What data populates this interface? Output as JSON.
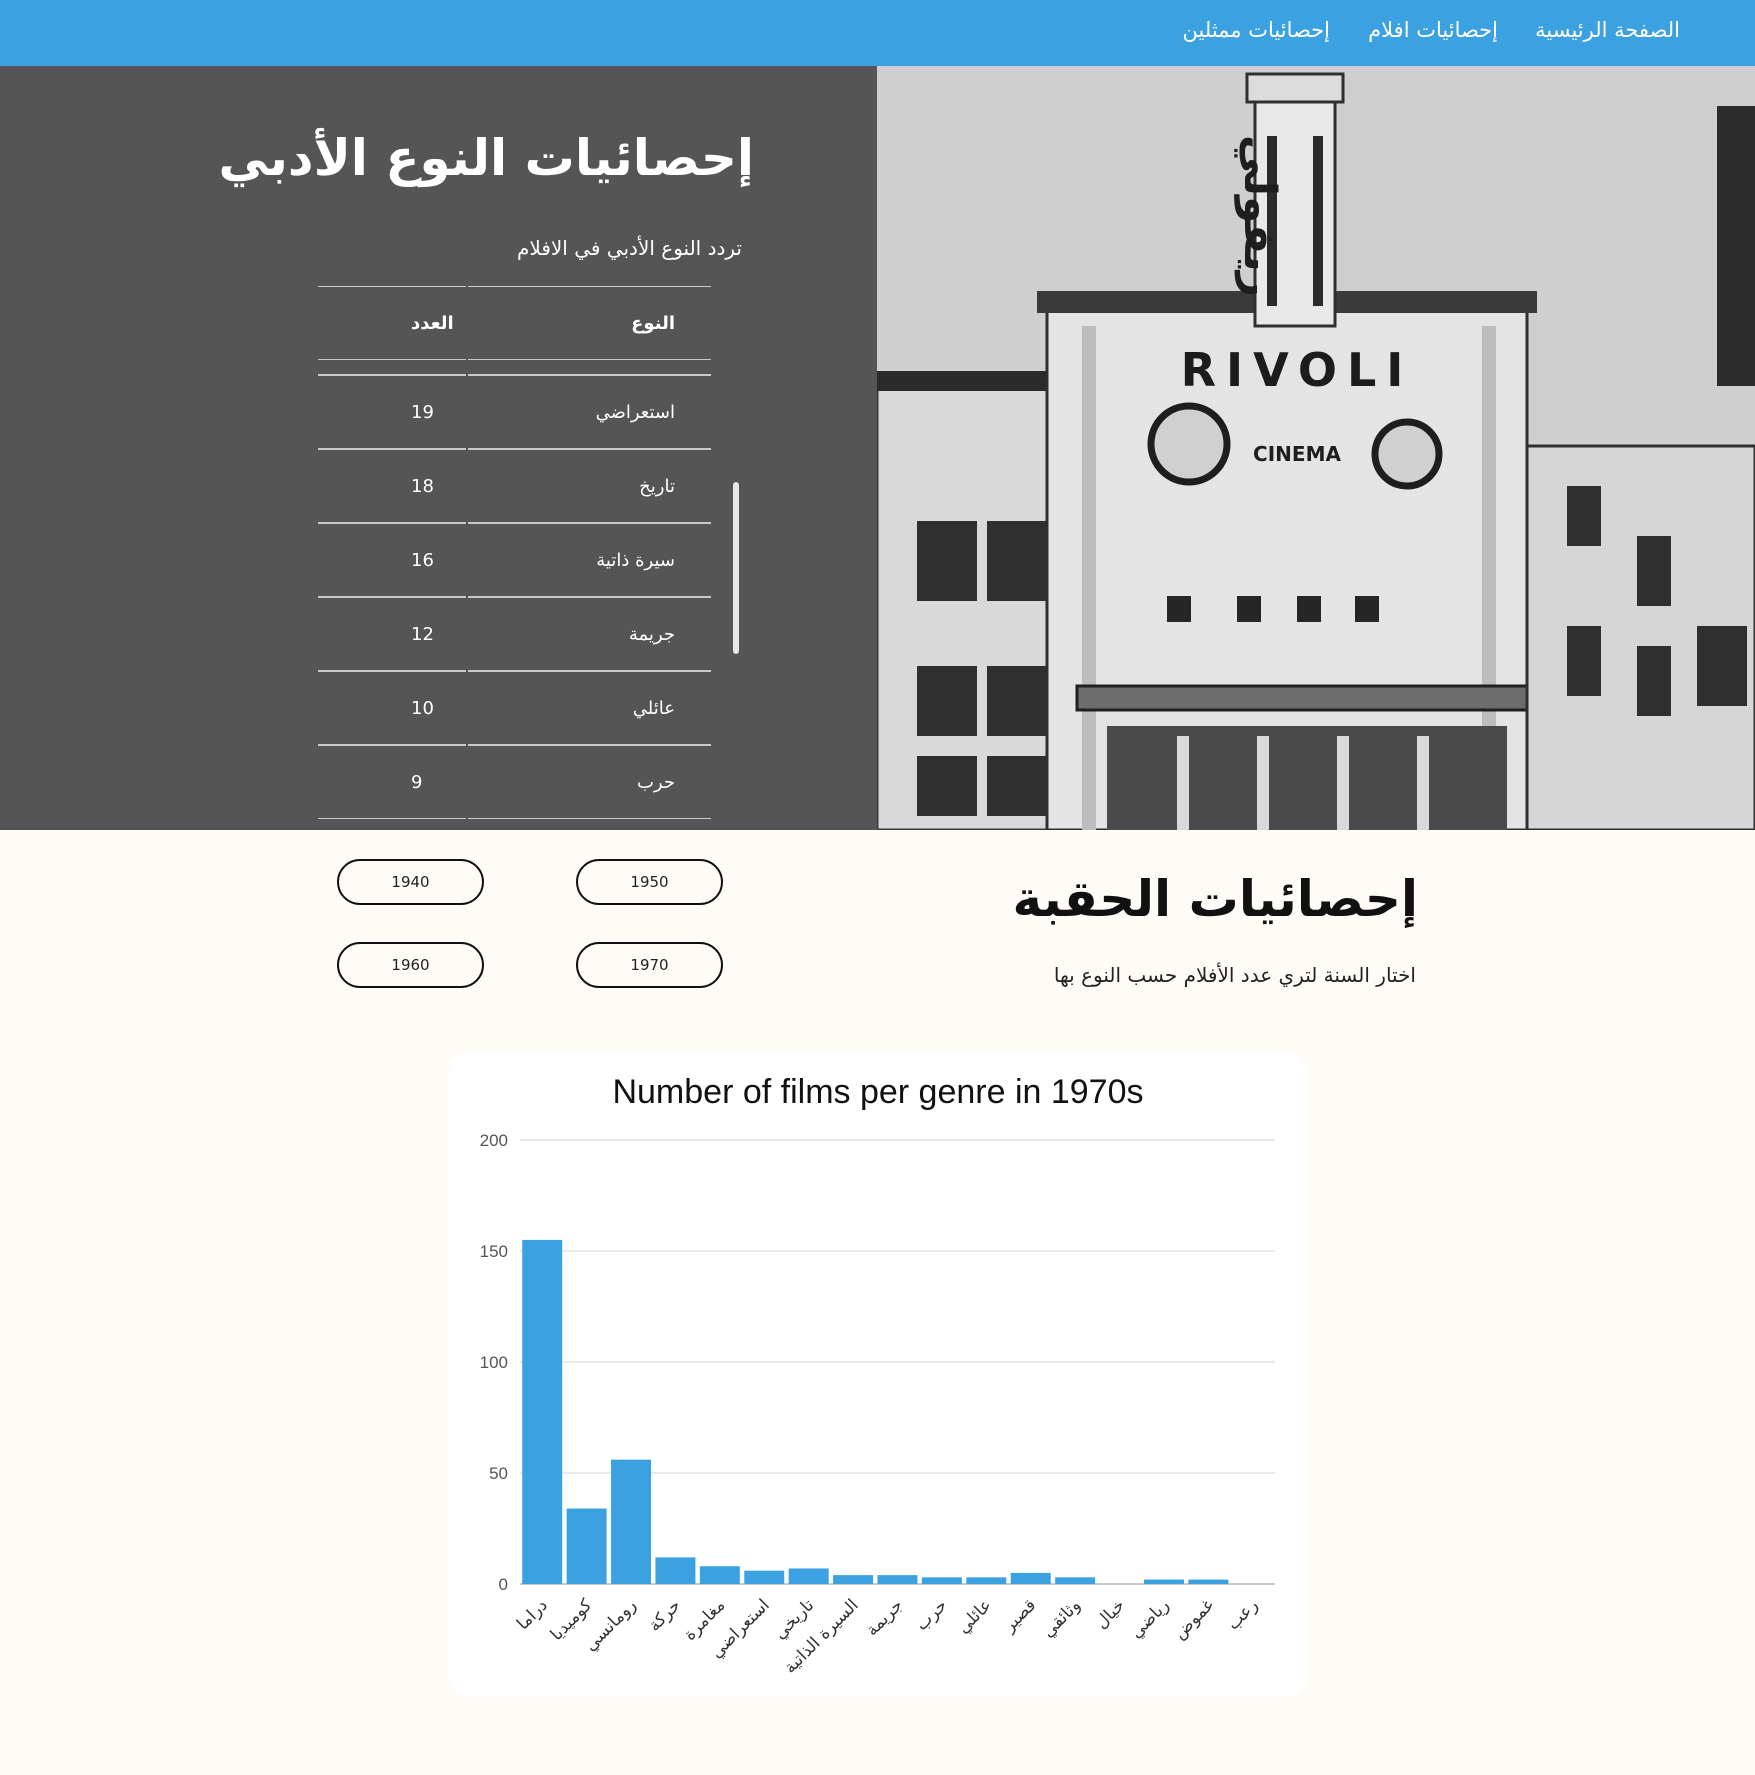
{
  "nav": {
    "home": "الصفحة الرئيسية",
    "films": "إحصائيات افلام",
    "actors": "إحصائيات ممثلين"
  },
  "hero": {
    "title": "إحصائيات النوع الأدبي",
    "subtitle": "تردد النوع الأدبي في الافلام",
    "table": {
      "headers": {
        "genre": "النوع",
        "count": "العدد"
      },
      "rows": [
        {
          "genre": "استعراضي",
          "count": "19"
        },
        {
          "genre": "تاريخ",
          "count": "18"
        },
        {
          "genre": "سيرة ذاتية",
          "count": "16"
        },
        {
          "genre": "جريمة",
          "count": "12"
        },
        {
          "genre": "عائلي",
          "count": "10"
        },
        {
          "genre": "حرب",
          "count": "9"
        }
      ]
    },
    "photo": {
      "sign_letters": "RIVOLI",
      "sign_small": "CINEMA",
      "tower_text": "ريفولي"
    }
  },
  "era": {
    "title": "إحصائيات الحقبة",
    "subtitle": "اختار السنة لتري عدد الأفلام حسب النوع بها",
    "decades": [
      "1940",
      "1950",
      "1960",
      "1970"
    ]
  },
  "chart_data": {
    "type": "bar",
    "title": "Number of films per genre in 1970s",
    "xlabel": "",
    "ylabel": "",
    "ylim": [
      0,
      200
    ],
    "yticks": [
      0,
      50,
      100,
      150,
      200
    ],
    "grid": true,
    "color": "#3ba1e1",
    "categories": [
      "دراما",
      "كوميديا",
      "رومانسي",
      "حركة",
      "مغامرة",
      "استعراضي",
      "تاريخي",
      "السيرة الذاتية",
      "جريمة",
      "حرب",
      "عائلي",
      "قصير",
      "وثائقي",
      "خيال",
      "رياضي",
      "غموض",
      "رعب"
    ],
    "values": [
      155,
      34,
      56,
      12,
      8,
      6,
      7,
      4,
      4,
      3,
      3,
      5,
      3,
      0,
      2,
      2,
      0
    ]
  }
}
